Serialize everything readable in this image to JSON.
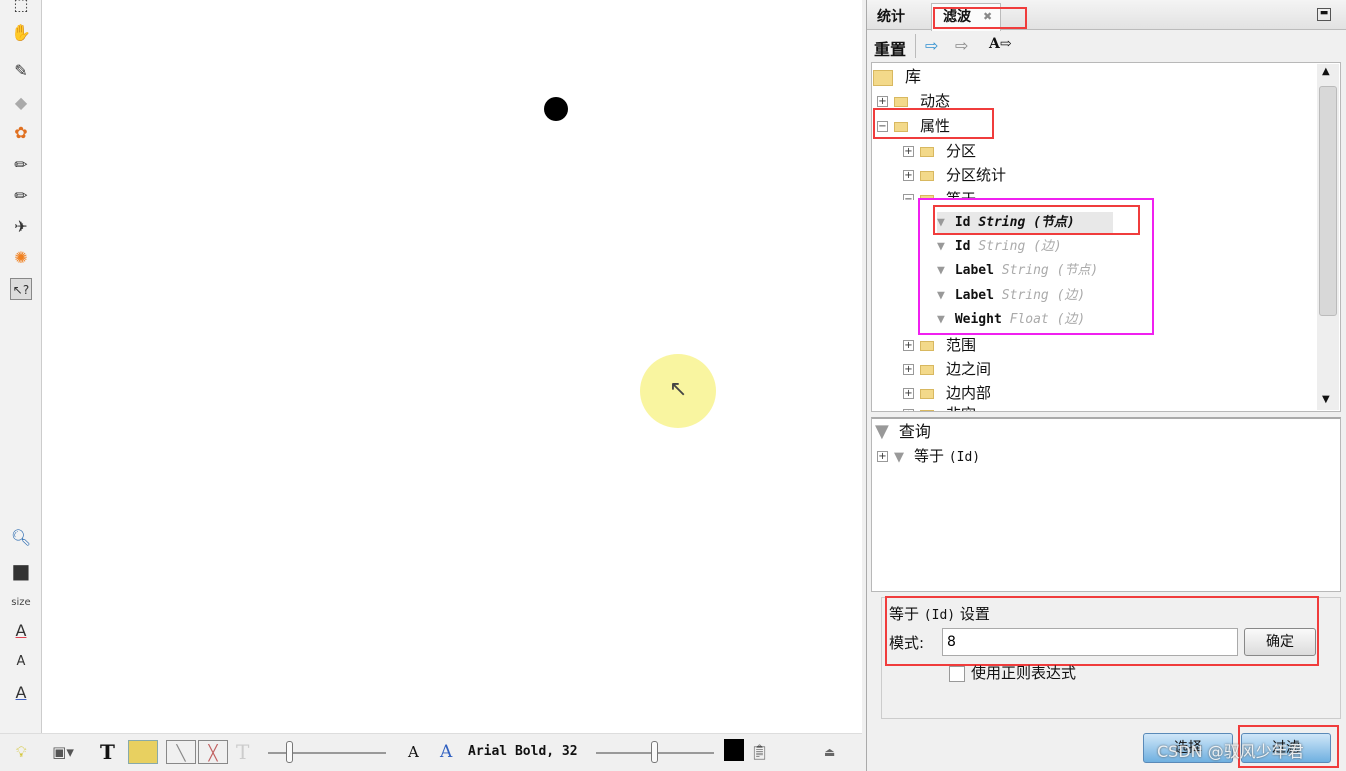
{
  "left_toolbar": {
    "icons": [
      "rectangle-select-icon",
      "lasso-icon",
      "brush-icon",
      "diamond-icon",
      "color-wheel-icon",
      "pencil-icon",
      "pencil-alt-icon",
      "plane-icon",
      "sun-icon",
      "help-pointer-icon",
      "zoom-search-icon",
      "color-square-icon",
      "label-color-icon",
      "label-size-icon",
      "label-font-icon"
    ],
    "size_label": "size"
  },
  "bottom_toolbar": {
    "font_label": "Arial Bold, 32",
    "text_tool": "T",
    "text_tool_disabled": "T",
    "font_decrease": "A",
    "font_increase": "A"
  },
  "panel": {
    "tabs": [
      {
        "label": "统计"
      },
      {
        "label": "滤波",
        "active": true
      }
    ],
    "toolbar": {
      "reset_label": "重置",
      "icon_text": "A"
    },
    "library": {
      "root": "库",
      "items": [
        {
          "label": "动态",
          "expanded": false
        },
        {
          "label": "属性",
          "expanded": true
        },
        {
          "label": "分区",
          "expanded": false
        },
        {
          "label": "分区统计",
          "expanded": false
        },
        {
          "label": "等于",
          "expanded": true
        },
        {
          "label": "范围",
          "expanded": false
        },
        {
          "label": "边之间",
          "expanded": false
        },
        {
          "label": "边内部",
          "expanded": false
        },
        {
          "label": "非空",
          "expanded": false
        }
      ],
      "equals_children": [
        {
          "name": "Id",
          "type": "String",
          "scope": "(节点)",
          "selected": true
        },
        {
          "name": "Id",
          "type": "String",
          "scope": "(边)"
        },
        {
          "name": "Label",
          "type": "String",
          "scope": "(节点)"
        },
        {
          "name": "Label",
          "type": "String",
          "scope": "(边)"
        },
        {
          "name": "Weight",
          "type": "Float",
          "scope": "(边)"
        }
      ]
    },
    "queries": {
      "root": "查询",
      "items": [
        {
          "label": "等于",
          "detail": "(Id)"
        }
      ]
    },
    "settings": {
      "title": "等于",
      "title_detail": "(Id)",
      "title_suffix": "设置",
      "pattern_label": "模式:",
      "pattern_value": "8",
      "ok_label": "确定",
      "regex_label": "使用正则表达式",
      "regex_checked": false
    },
    "select_label": "选择",
    "filter_label": "过滤",
    "watermark": "CSDN @驭风少年君"
  },
  "colors": {
    "highlight_red": "#f03c3c",
    "highlight_magenta": "#f020f0",
    "accent_blue": "#6fb0e0"
  }
}
